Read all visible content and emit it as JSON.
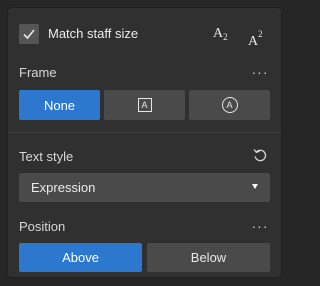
{
  "match_staff": {
    "label": "Match staff size",
    "checked": true
  },
  "script_buttons": {
    "subscript": {
      "letter": "A",
      "mark": "2"
    },
    "superscript": {
      "letter": "A",
      "mark": "2"
    }
  },
  "frame": {
    "title": "Frame",
    "more": "···",
    "options": [
      {
        "label": "None",
        "icon": "",
        "selected": true
      },
      {
        "label": "",
        "icon": "square-frame-icon",
        "selected": false
      },
      {
        "label": "",
        "icon": "circle-frame-icon",
        "selected": false
      }
    ],
    "square_letter": "A",
    "circle_letter": "A"
  },
  "text_style": {
    "title": "Text style",
    "value": "Expression"
  },
  "position": {
    "title": "Position",
    "more": "···",
    "options": [
      {
        "label": "Above",
        "selected": true
      },
      {
        "label": "Below",
        "selected": false
      }
    ]
  },
  "colors": {
    "accent": "#2d78cf",
    "panel": "#303030",
    "button": "#4a4a4a"
  }
}
